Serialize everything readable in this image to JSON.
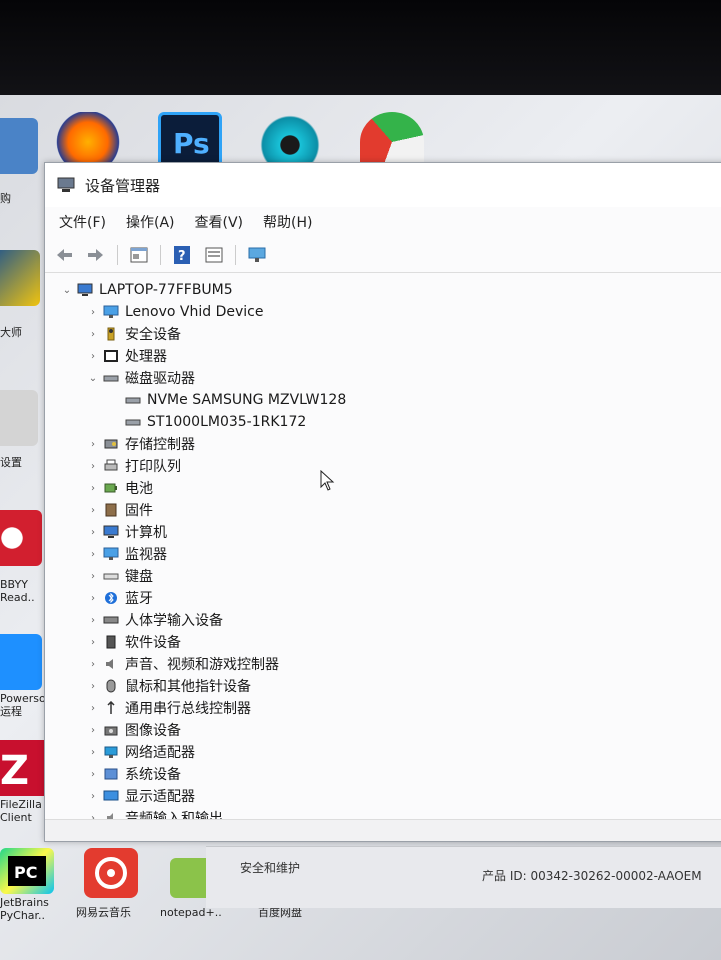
{
  "window": {
    "title": "设备管理器"
  },
  "menu": [
    {
      "label": "文件(F)"
    },
    {
      "label": "操作(A)"
    },
    {
      "label": "查看(V)"
    },
    {
      "label": "帮助(H)"
    }
  ],
  "tree": {
    "root": "LAPTOP-77FFBUM5",
    "nodes": [
      {
        "label": "Lenovo Vhid Device",
        "expander": "›",
        "icon": "monitor-icon"
      },
      {
        "label": "安全设备",
        "expander": "›",
        "icon": "key-icon"
      },
      {
        "label": "处理器",
        "expander": "›",
        "icon": "chip-icon"
      },
      {
        "label": "磁盘驱动器",
        "expander": "⌄",
        "icon": "disk-icon"
      },
      {
        "label": "存储控制器",
        "expander": "›",
        "icon": "storage-icon"
      },
      {
        "label": "打印队列",
        "expander": "›",
        "icon": "printer-icon"
      },
      {
        "label": "电池",
        "expander": "›",
        "icon": "battery-icon"
      },
      {
        "label": "固件",
        "expander": "›",
        "icon": "firmware-icon"
      },
      {
        "label": "计算机",
        "expander": "›",
        "icon": "computer-icon"
      },
      {
        "label": "监视器",
        "expander": "›",
        "icon": "monitor-icon"
      },
      {
        "label": "键盘",
        "expander": "›",
        "icon": "keyboard-icon"
      },
      {
        "label": "蓝牙",
        "expander": "›",
        "icon": "bluetooth-icon"
      },
      {
        "label": "人体学输入设备",
        "expander": "›",
        "icon": "hid-icon"
      },
      {
        "label": "软件设备",
        "expander": "›",
        "icon": "software-icon"
      },
      {
        "label": "声音、视频和游戏控制器",
        "expander": "›",
        "icon": "speaker-icon"
      },
      {
        "label": "鼠标和其他指针设备",
        "expander": "›",
        "icon": "mouse-icon"
      },
      {
        "label": "通用串行总线控制器",
        "expander": "›",
        "icon": "usb-icon"
      },
      {
        "label": "图像设备",
        "expander": "›",
        "icon": "camera-icon"
      },
      {
        "label": "网络适配器",
        "expander": "›",
        "icon": "network-icon"
      },
      {
        "label": "系统设备",
        "expander": "›",
        "icon": "system-icon"
      },
      {
        "label": "显示适配器",
        "expander": "›",
        "icon": "display-icon"
      },
      {
        "label": "音频输入和输出",
        "expander": "›",
        "icon": "audio-icon"
      }
    ],
    "disk_children": [
      {
        "label": "NVMe SAMSUNG MZVLW128"
      },
      {
        "label": "ST1000LM035-1RK172"
      }
    ]
  },
  "desktop": {
    "labels": [
      "购",
      "大师",
      "设置",
      "BBYY\nRead..",
      "Powersoft\n运程",
      "FileZilla\nClient",
      "JetBrains\nPyChar..",
      "网易云音乐",
      "notepad+..",
      "百度网盘"
    ]
  },
  "lower": {
    "left_text": "安全和维护",
    "right_text": "产品 ID: 00342-30262-00002-AAOEM"
  },
  "colors": {
    "window_bg": "#fbfbfc",
    "accent_blue": "#2b7bd6"
  }
}
